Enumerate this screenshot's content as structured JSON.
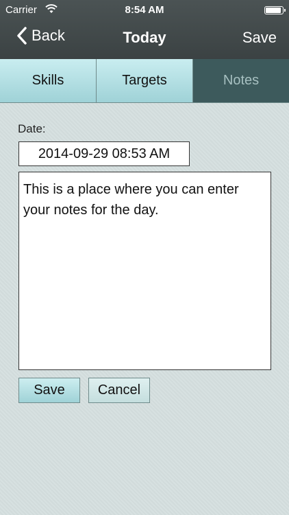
{
  "status_bar": {
    "carrier": "Carrier",
    "time": "8:54 AM",
    "battery_level": 1.0,
    "icons": [
      "wifi-icon",
      "battery-icon"
    ]
  },
  "nav_bar": {
    "back_label": "Back",
    "title": "Today",
    "save_label": "Save"
  },
  "tabs": [
    {
      "label": "Skills",
      "active": false
    },
    {
      "label": "Targets",
      "active": false
    },
    {
      "label": "Notes",
      "active": true
    }
  ],
  "form": {
    "date_label": "Date:",
    "date_value": "2014-09-29 08:53 AM",
    "notes_value": "This is a place where you can enter your notes for the day.",
    "save_button": "Save",
    "cancel_button": "Cancel"
  },
  "colors": {
    "nav_background": "#434a4b",
    "tab_inactive": "#b3e2e6",
    "tab_active": "#3d5a5c",
    "content_background": "#d5dfdf"
  }
}
